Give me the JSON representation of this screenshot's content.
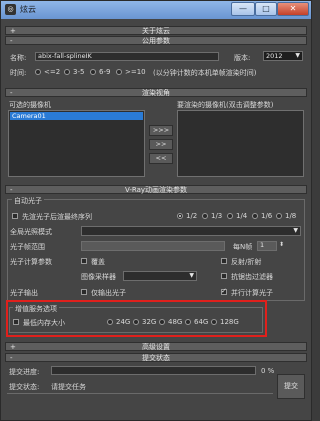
{
  "window": {
    "title": "炫云",
    "minimize_label": "—",
    "maximize_label": "□",
    "close_label": "✕"
  },
  "about": {
    "bar_label": "关于炫云",
    "sign": "+"
  },
  "common": {
    "bar_label": "公用参数",
    "sign": "-",
    "name_label": "名称:",
    "name_value": "abix-fall-splineIK",
    "version_label": "版本:",
    "version_value": "2012",
    "time_label": "时间:",
    "time_options": [
      "<=2",
      "3-5",
      "6-9",
      ">=10"
    ],
    "time_note": "(以分钟计数的本机单帧渲染时间)"
  },
  "cameras": {
    "bar_label": "渲染视角",
    "sign": "-",
    "available_label": "可选的摄像机",
    "selected_label": "要渲染的摄像机(双击调整参数)",
    "available_items": [
      "Camera01"
    ],
    "btn_add_all": ">>>",
    "btn_add": ">>",
    "btn_remove": "<<"
  },
  "vray": {
    "bar_label": "V-Ray动画渲染参数",
    "sign": "-",
    "auto_photon_label": "自动光子",
    "photon_first_label": "先渲光子后渲最终序列",
    "ratio_options": [
      "1/2",
      "1/3",
      "1/4",
      "1/6",
      "1/8"
    ],
    "gi_mode_label": "全局光照模式",
    "photon_range_label": "光子帧范围",
    "every_n_label": "每N帧",
    "every_n_value": "1",
    "photon_calc_label": "光子计算参数",
    "overwrite_label": "覆盖",
    "reflect_refract_label": "反射/折射",
    "image_sampler_label": "图像采样器",
    "antialias_filter_label": "抗锯齿过滤器",
    "photon_output_label": "光子输出",
    "only_output_photon_label": "仅输出光子",
    "parallel_photon_label": "并行计算光子"
  },
  "value_added": {
    "title": "增值服务选项",
    "max_memory_label": "最低内存大小",
    "memory_options": [
      "24G",
      "32G",
      "48G",
      "64G",
      "128G"
    ]
  },
  "advanced": {
    "bar_label": "高级设置",
    "sign": "+"
  },
  "submit": {
    "bar_label": "提交状态",
    "sign": "-",
    "progress_label": "提交进度:",
    "progress_percent": 0,
    "progress_text": "0 %",
    "status_label": "提交状态:",
    "status_value": "请提交任务",
    "submit_button": "提交"
  }
}
